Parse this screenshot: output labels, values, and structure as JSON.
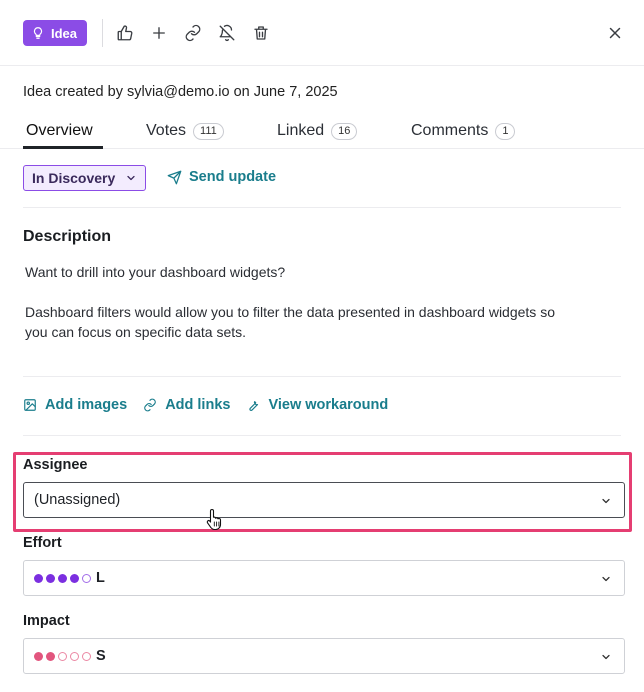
{
  "toolbar": {
    "type_badge": "Idea",
    "icons": [
      "lightbulb-icon",
      "thumbs-up-icon",
      "plus-icon",
      "link-icon",
      "bell-off-icon",
      "trash-icon",
      "close-icon"
    ]
  },
  "meta": {
    "created_text": "Idea created by sylvia@demo.io on June 7, 2025"
  },
  "tabs": [
    {
      "label": "Overview",
      "count": null,
      "active": true
    },
    {
      "label": "Votes",
      "count": "111",
      "active": false
    },
    {
      "label": "Linked",
      "count": "16",
      "active": false
    },
    {
      "label": "Comments",
      "count": "1",
      "active": false
    }
  ],
  "status": {
    "value": "In Discovery",
    "send_update_label": "Send update"
  },
  "description": {
    "title": "Description",
    "line1": "Want to drill into your dashboard widgets?",
    "line2": "Dashboard filters would allow you to filter the data presented in dashboard widgets so",
    "line3": "you can focus on specific data sets."
  },
  "actions": {
    "add_images": "Add images",
    "add_links": "Add links",
    "view_workaround": "View workaround"
  },
  "fields": {
    "assignee": {
      "label": "Assignee",
      "value": "(Unassigned)"
    },
    "effort": {
      "label": "Effort",
      "value": "L",
      "level": 4,
      "max": 5,
      "color": "#7b2fe0"
    },
    "impact": {
      "label": "Impact",
      "value": "S",
      "level": 2,
      "max": 5,
      "color": "#e2557e"
    }
  },
  "colors": {
    "accent_purple": "#8b4ce6",
    "link_teal": "#1a7d8c",
    "highlight_pink": "#e53e72"
  }
}
